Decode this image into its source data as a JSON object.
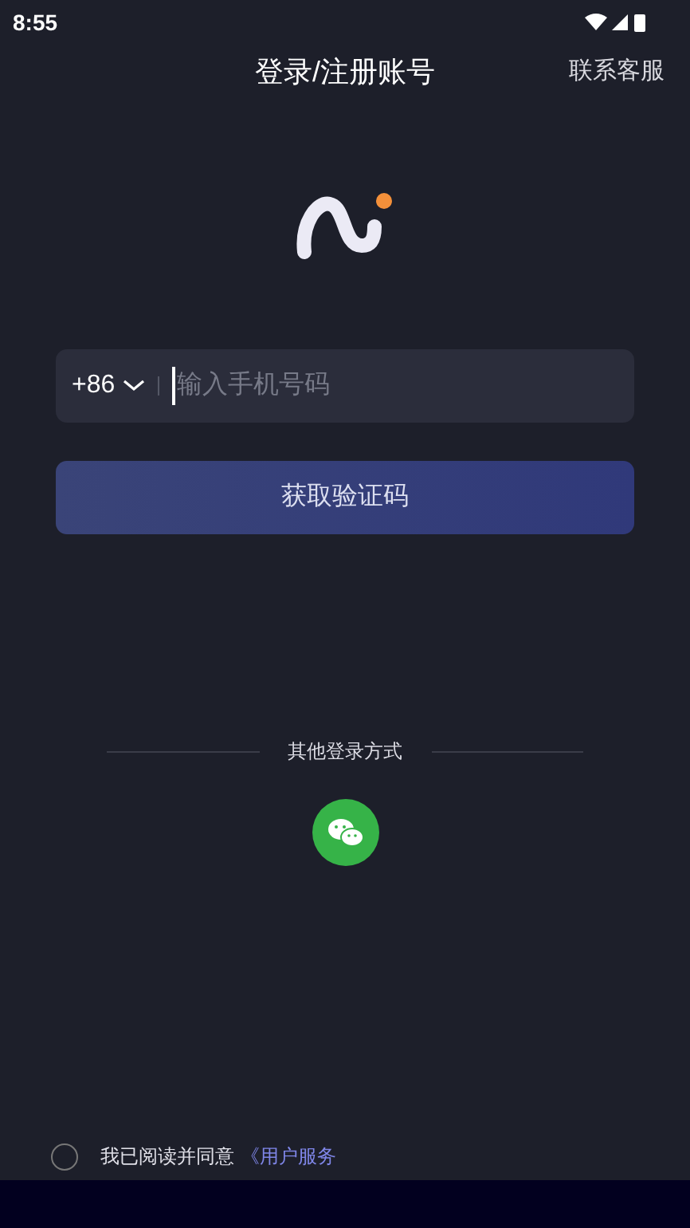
{
  "status_bar": {
    "time": "8:55"
  },
  "header": {
    "title": "登录/注册账号",
    "action": "联系客服"
  },
  "phone_field": {
    "country_code": "+86",
    "placeholder": "输入手机号码"
  },
  "submit_button": "获取验证码",
  "other_login": {
    "label": "其他登录方式"
  },
  "agreement": {
    "checked": false,
    "text": "我已阅读并同意",
    "link": "《用户服务"
  }
}
